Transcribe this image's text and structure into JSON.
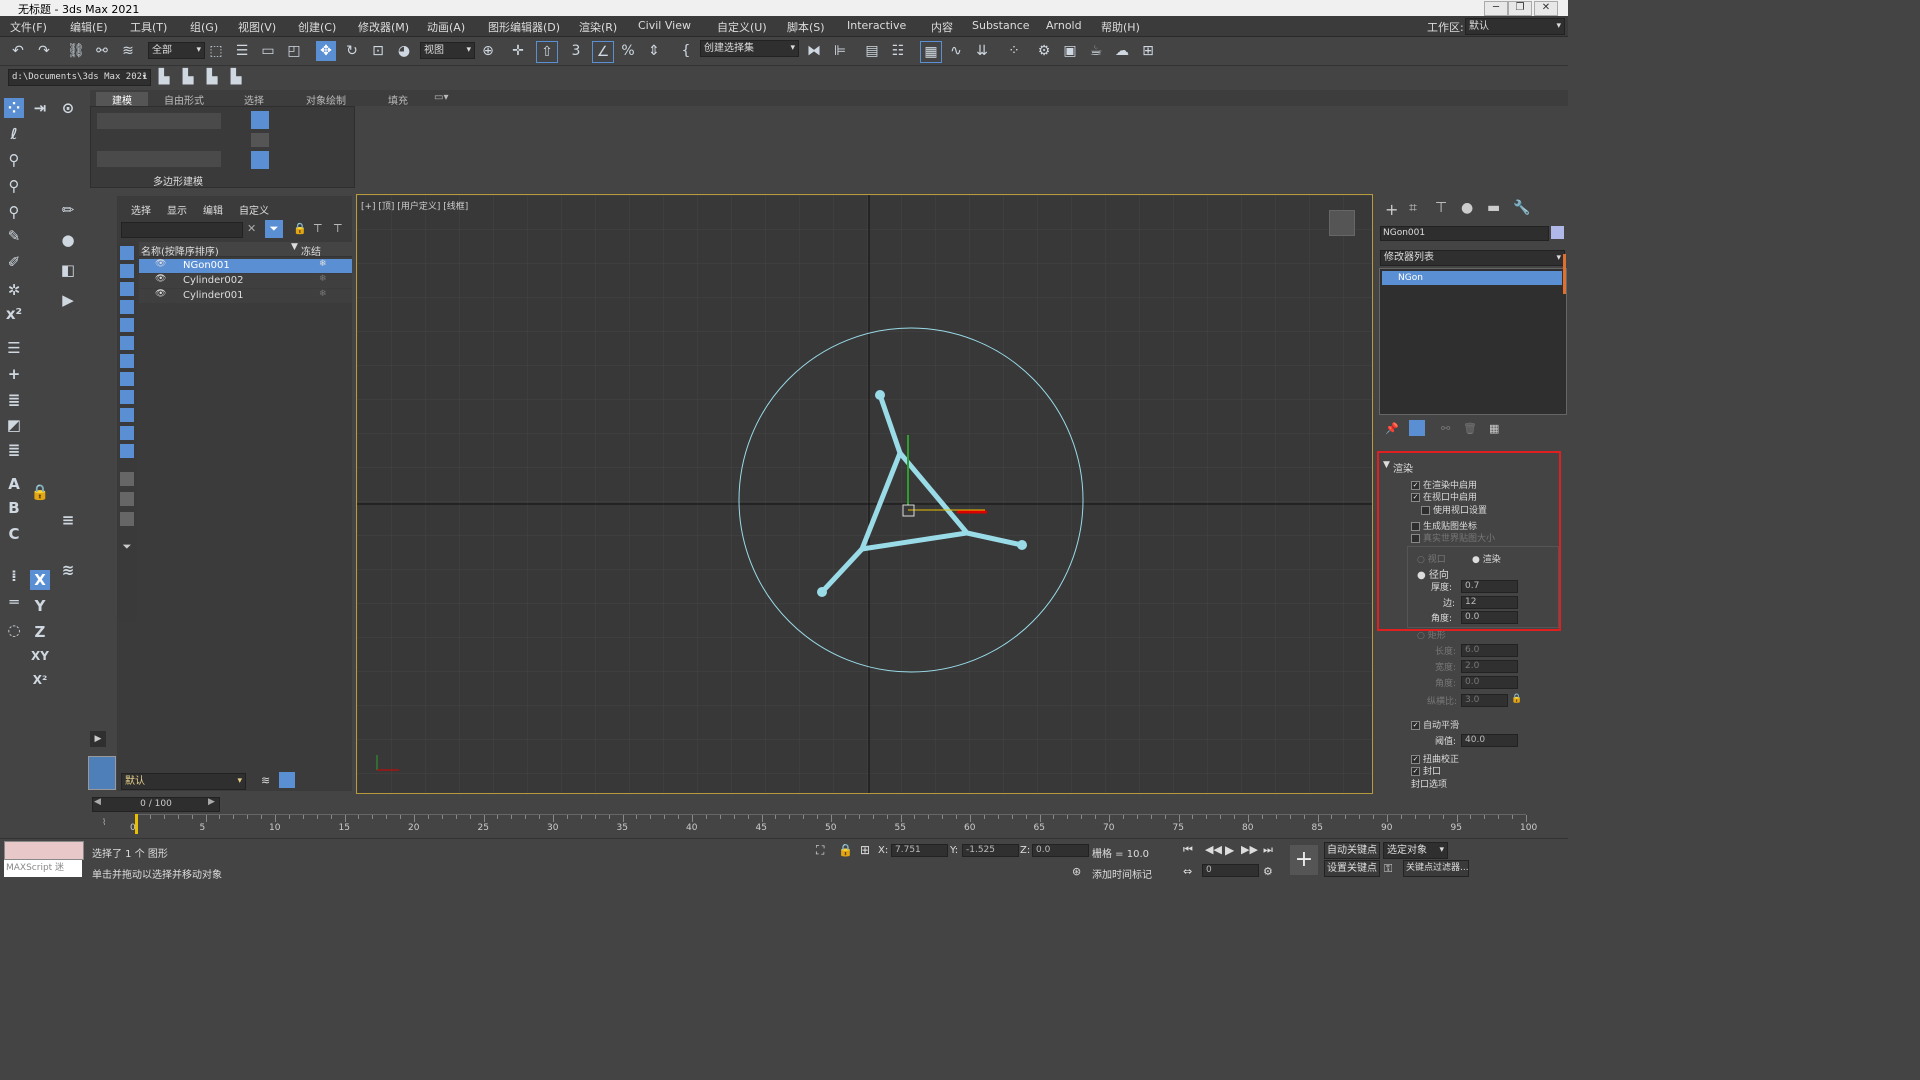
{
  "window": {
    "title": "无标题 - 3ds Max 2021",
    "controls": [
      "─",
      "❐",
      "✕"
    ]
  },
  "menus": [
    "文件(F)",
    "编辑(E)",
    "工具(T)",
    "组(G)",
    "视图(V)",
    "创建(C)",
    "修改器(M)",
    "动画(A)",
    "图形编辑器(D)",
    "渲染(R)",
    "Civil View",
    "自定义(U)",
    "脚本(S)",
    "Interactive",
    "内容",
    "Substance",
    "Arnold",
    "帮助(H)"
  ],
  "workspace": {
    "label": "工作区:",
    "value": "默认"
  },
  "toolbar": {
    "filter_value": "全部",
    "coord_value": "视图",
    "selection_set": "创建选择集"
  },
  "project_path": "d:\\Documents\\3ds Max 2021",
  "ribbon": {
    "tabs": [
      "建模",
      "自由形式",
      "选择",
      "对象绘制",
      "填充"
    ],
    "panel_label": "多边形建模"
  },
  "scene_explorer": {
    "tabs": [
      "选择",
      "显示",
      "编辑",
      "自定义"
    ],
    "col_name": "名称(按降序排序)",
    "col_freeze": "冻结",
    "items": [
      "NGon001",
      "Cylinder002",
      "Cylinder001"
    ],
    "layer": "默认"
  },
  "viewport": {
    "label": "[+] [顶] [用户定义] [线框]"
  },
  "command_panel": {
    "object_name": "NGon001",
    "modifier_list_label": "修改器列表",
    "stack_item": "NGon",
    "rollout_title": "渲染",
    "options": {
      "enable_render": "在渲染中启用",
      "enable_viewport": "在视口中启用",
      "use_viewport_settings": "使用视口设置",
      "gen_mapping": "生成贴图坐标",
      "real_world": "真实世界贴图大小",
      "viewport_radio": "视口",
      "render_radio": "渲染",
      "radial": "径向",
      "thickness_label": "厚度:",
      "thickness_value": "0.7",
      "sides_label": "边:",
      "sides_value": "12",
      "angle_label": "角度:",
      "angle_value": "0.0",
      "rectangular": "矩形",
      "length_label": "长度:",
      "length_value": "6.0",
      "width_label": "宽度:",
      "width_value": "2.0",
      "angle2_label": "角度:",
      "angle2_value": "0.0",
      "aspect_label": "纵横比:",
      "aspect_value": "3.0",
      "auto_smooth": "自动平滑",
      "threshold_label": "阈值:",
      "threshold_value": "40.0",
      "twist_correct": "扭曲校正",
      "cap": "封口",
      "cap_options": "封口选项"
    }
  },
  "timeline": {
    "frame_display": "0 / 100",
    "ticks": [
      "0",
      "5",
      "10",
      "15",
      "20",
      "25",
      "30",
      "35",
      "40",
      "45",
      "50",
      "55",
      "60",
      "65",
      "70",
      "75",
      "80",
      "85",
      "90",
      "95",
      "100"
    ]
  },
  "status": {
    "maxscript": "MAXScript 迷",
    "line1": "选择了 1 个 图形",
    "line2": "单击并拖动以选择并移动对象",
    "x_label": "X:",
    "x_value": "7.751",
    "y_label": "Y:",
    "y_value": "-1.525",
    "z_label": "Z:",
    "z_value": "0.0",
    "grid": "栅格 = 10.0",
    "add_time_tag": "添加时间标记",
    "auto_key": "自动关键点",
    "set_key": "设置关键点",
    "selected_obj": "选定对象",
    "key_filters": "关键点过滤器...",
    "frame_value": "0"
  },
  "colors": {
    "accent": "#5b8fd4",
    "highlight_box": "#e02020",
    "shape": "#9adbe8"
  }
}
